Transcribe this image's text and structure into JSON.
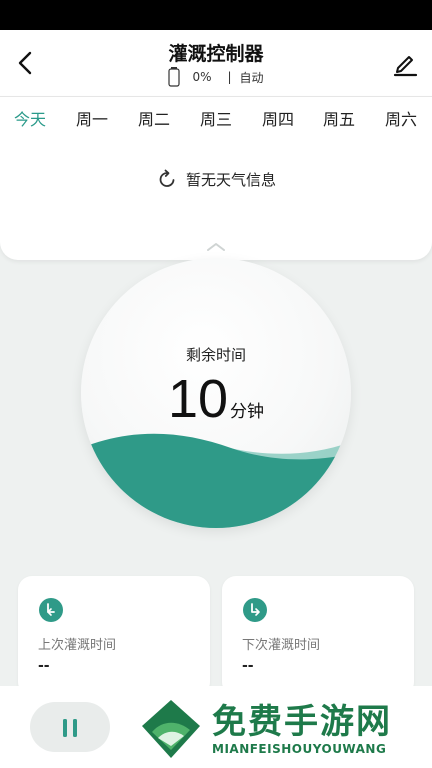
{
  "header": {
    "title": "灌溉控制器",
    "battery": "0%",
    "separator": "|",
    "mode": "自动"
  },
  "tabs": [
    {
      "label": "今天",
      "active": true
    },
    {
      "label": "周一"
    },
    {
      "label": "周二"
    },
    {
      "label": "周三"
    },
    {
      "label": "周四"
    },
    {
      "label": "周五"
    },
    {
      "label": "周六"
    }
  ],
  "weather": {
    "message": "暂无天气信息"
  },
  "remaining": {
    "label": "剩余时间",
    "value": "10",
    "unit": "分钟"
  },
  "cards": {
    "last": {
      "label": "上次灌溉时间",
      "value": "--"
    },
    "next": {
      "label": "下次灌溉时间",
      "value": "--"
    }
  },
  "watermark": {
    "text": "免费手游网",
    "sub": "MIANFEISHOUYOUWANG"
  },
  "colors": {
    "accent": "#2a9a8a",
    "wave_dark": "#2f9a88",
    "wave_light": "#7cc6b8",
    "watermark_green": "#1e7a4a"
  }
}
